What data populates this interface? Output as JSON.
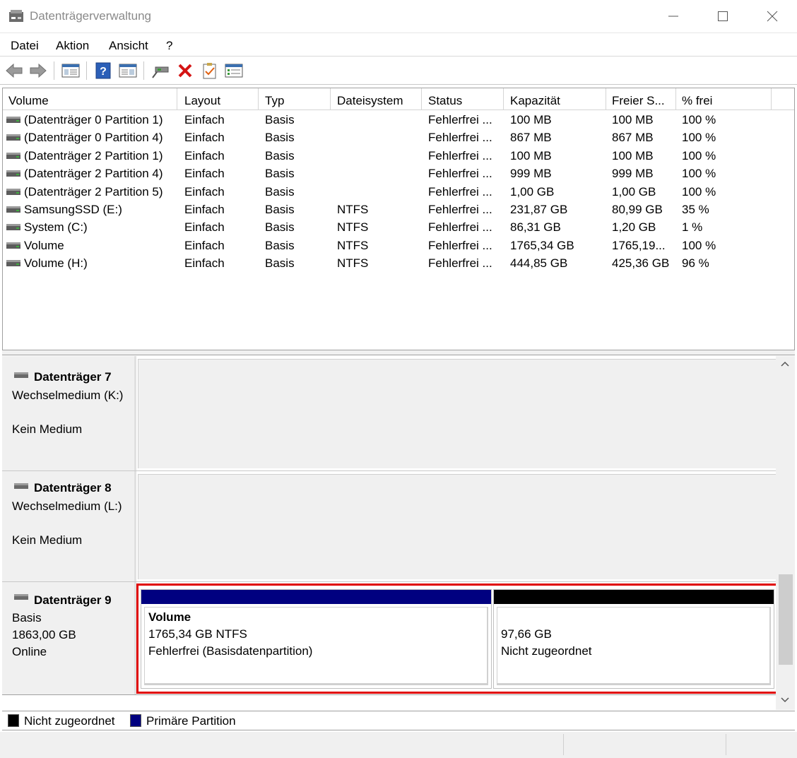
{
  "window": {
    "title": "Datenträgerverwaltung",
    "controls": {
      "minimize": "minimize-icon",
      "maximize": "maximize-icon",
      "close": "close-icon"
    }
  },
  "menu": [
    "Datei",
    "Aktion",
    "Ansicht",
    "?"
  ],
  "toolbar": {
    "buttons": [
      "back-arrow-icon",
      "forward-arrow-icon",
      "console-tree-icon",
      "help-icon",
      "details-pane-icon",
      "connect-icon",
      "delete-icon",
      "checklist-icon",
      "properties-icon"
    ]
  },
  "columns": [
    "Volume",
    "Layout",
    "Typ",
    "Dateisystem",
    "Status",
    "Kapazität",
    "Freier S...",
    "% frei"
  ],
  "volumes": [
    [
      "(Datenträger 0 Partition 1)",
      "Einfach",
      "Basis",
      "",
      "Fehlerfrei ...",
      "100 MB",
      "100 MB",
      "100 %"
    ],
    [
      "(Datenträger 0 Partition 4)",
      "Einfach",
      "Basis",
      "",
      "Fehlerfrei ...",
      "867 MB",
      "867 MB",
      "100 %"
    ],
    [
      "(Datenträger 2 Partition 1)",
      "Einfach",
      "Basis",
      "",
      "Fehlerfrei ...",
      "100 MB",
      "100 MB",
      "100 %"
    ],
    [
      "(Datenträger 2 Partition 4)",
      "Einfach",
      "Basis",
      "",
      "Fehlerfrei ...",
      "999 MB",
      "999 MB",
      "100 %"
    ],
    [
      "(Datenträger 2 Partition 5)",
      "Einfach",
      "Basis",
      "",
      "Fehlerfrei ...",
      "1,00 GB",
      "1,00 GB",
      "100 %"
    ],
    [
      "SamsungSSD (E:)",
      "Einfach",
      "Basis",
      "NTFS",
      "Fehlerfrei ...",
      "231,87 GB",
      "80,99 GB",
      "35 %"
    ],
    [
      "System (C:)",
      "Einfach",
      "Basis",
      "NTFS",
      "Fehlerfrei ...",
      "86,31 GB",
      "1,20 GB",
      "1 %"
    ],
    [
      "Volume",
      "Einfach",
      "Basis",
      "NTFS",
      "Fehlerfrei ...",
      "1765,34 GB",
      "1765,19...",
      "100 %"
    ],
    [
      "Volume (H:)",
      "Einfach",
      "Basis",
      "NTFS",
      "Fehlerfrei ...",
      "444,85 GB",
      "425,36 GB",
      "96 %"
    ]
  ],
  "disks": {
    "disk7": {
      "name": "Datenträger 7",
      "line1": "Wechselmedium (K:)",
      "line2": "Kein Medium"
    },
    "disk8": {
      "name": "Datenträger 8",
      "line1": "Wechselmedium (L:)",
      "line2": "Kein Medium"
    },
    "disk9": {
      "name": "Datenträger 9",
      "type": "Basis",
      "size": "1863,00 GB",
      "state": "Online",
      "partitions": {
        "primary": {
          "name": "Volume",
          "size": "1765,34 GB NTFS",
          "status": "Fehlerfrei (Basisdatenpartition)",
          "color": "#000080"
        },
        "unallocated": {
          "size": "97,66 GB",
          "status": "Nicht zugeordnet",
          "color": "#000000"
        }
      }
    }
  },
  "legend": {
    "unallocated": {
      "label": "Nicht zugeordnet",
      "color": "#000000"
    },
    "primary": {
      "label": "Primäre Partition",
      "color": "#000080"
    }
  },
  "colors": {
    "highlight_frame": "#e00000"
  }
}
